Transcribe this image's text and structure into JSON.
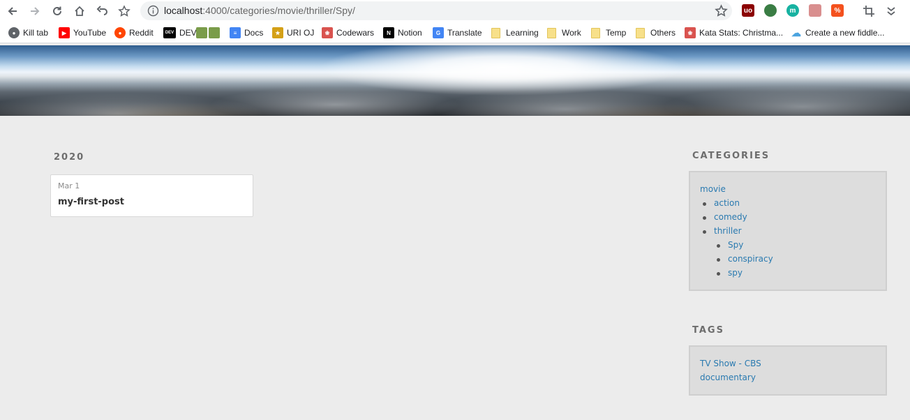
{
  "browser": {
    "url_host": "localhost",
    "url_rest": ":4000/categories/movie/thriller/Spy/",
    "extensions": [
      {
        "name": "ublock-icon",
        "text": "uo",
        "color": "#8b0000"
      },
      {
        "name": "globe-extension-icon",
        "text": "",
        "color": "#3a7d44"
      },
      {
        "name": "m-extension-icon",
        "text": "m",
        "color": "#17b2a1"
      },
      {
        "name": "reload-extension-icon",
        "text": "",
        "color": "#d98f8f"
      },
      {
        "name": "percent-extension-icon",
        "text": "%",
        "color": "#f4511e"
      }
    ]
  },
  "bookmarks": [
    {
      "label": "Kill tab",
      "icon": "globe",
      "color": "#5f6368"
    },
    {
      "label": "YouTube",
      "icon": "youtube",
      "color": "#ff0000"
    },
    {
      "label": "Reddit",
      "icon": "reddit",
      "color": "#ff4500"
    },
    {
      "label": "DEV",
      "icon": "dev",
      "color": "#000000"
    },
    {
      "label": "Docs",
      "icon": "docs",
      "color": "#4285f4"
    },
    {
      "label": "URI OJ",
      "icon": "trophy",
      "color": "#d4a017"
    },
    {
      "label": "Codewars",
      "icon": "codewars",
      "color": "#d9534f"
    },
    {
      "label": "Notion",
      "icon": "notion",
      "color": "#000000"
    },
    {
      "label": "Translate",
      "icon": "translate",
      "color": "#4285f4"
    },
    {
      "label": "Learning",
      "icon": "folder",
      "color": "#f7e08a"
    },
    {
      "label": "Work",
      "icon": "folder",
      "color": "#f7e08a"
    },
    {
      "label": "Temp",
      "icon": "folder",
      "color": "#f7e08a"
    },
    {
      "label": "Others",
      "icon": "folder",
      "color": "#f7e08a"
    },
    {
      "label": "Kata Stats: Christma...",
      "icon": "codewars",
      "color": "#d9534f"
    },
    {
      "label": "Create a new fiddle...",
      "icon": "cloud",
      "color": "#4aa3df"
    }
  ],
  "archive": {
    "year": "2020",
    "posts": [
      {
        "date": "Mar 1",
        "title": "my-first-post"
      }
    ]
  },
  "sidebar": {
    "categories_heading": "CATEGORIES",
    "categories": {
      "root": "movie",
      "children": [
        "action",
        "comedy",
        "thriller"
      ],
      "thriller_children": [
        "Spy",
        "conspiracy",
        "spy"
      ]
    },
    "tags_heading": "TAGS",
    "tags": [
      "TV Show - CBS",
      "documentary"
    ]
  },
  "colors": {
    "link": "#2a7ab0",
    "page_bg": "#ececec",
    "sidebar_box": "#dddddd"
  }
}
